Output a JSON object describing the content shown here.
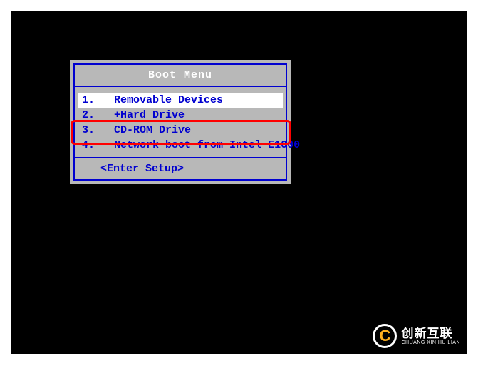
{
  "menu": {
    "title": "Boot Menu",
    "items": [
      {
        "num": "1.",
        "label": "Removable Devices",
        "selected": true
      },
      {
        "num": "2.",
        "label": "+Hard Drive",
        "selected": false
      },
      {
        "num": "3.",
        "label": "CD-ROM Drive",
        "selected": false
      },
      {
        "num": "4.",
        "label": "Network boot from Intel E1000",
        "selected": false
      }
    ],
    "footer": "<Enter Setup>"
  },
  "watermark": {
    "icon_letter": "C",
    "main": "创新互联",
    "sub": "CHUANG XIN HU LIAN"
  }
}
